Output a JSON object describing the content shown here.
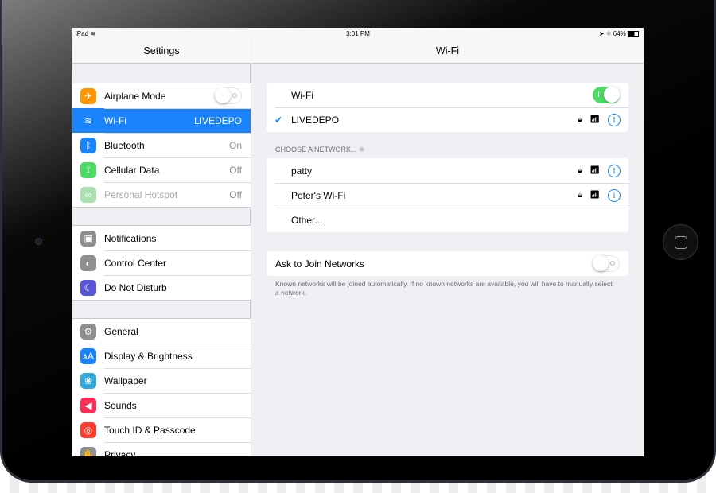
{
  "status": {
    "device": "iPad",
    "time": "3:01 PM",
    "battery": "64%"
  },
  "sidebar": {
    "title": "Settings",
    "groups": [
      [
        {
          "label": "Airplane Mode",
          "icon": "airplane-icon",
          "color": "#ff9500",
          "toggle": false
        },
        {
          "label": "Wi-Fi",
          "icon": "wifi-icon",
          "color": "#1a82fb",
          "value": "LIVEDEPO",
          "selected": true
        },
        {
          "label": "Bluetooth",
          "icon": "bluetooth-icon",
          "color": "#1a82fb",
          "value": "On"
        },
        {
          "label": "Cellular Data",
          "icon": "antenna-icon",
          "color": "#4cd964",
          "value": "Off"
        },
        {
          "label": "Personal Hotspot",
          "icon": "hotspot-icon",
          "color": "#a8e0b0",
          "value": "Off",
          "disabled": true
        }
      ],
      [
        {
          "label": "Notifications",
          "icon": "notifications-icon",
          "color": "#8e8e93"
        },
        {
          "label": "Control Center",
          "icon": "control-center-icon",
          "color": "#8e8e93"
        },
        {
          "label": "Do Not Disturb",
          "icon": "moon-icon",
          "color": "#5856d6"
        }
      ],
      [
        {
          "label": "General",
          "icon": "gear-icon",
          "color": "#8e8e93"
        },
        {
          "label": "Display & Brightness",
          "icon": "display-icon",
          "color": "#1a82fb"
        },
        {
          "label": "Wallpaper",
          "icon": "wallpaper-icon",
          "color": "#34aadc"
        },
        {
          "label": "Sounds",
          "icon": "speaker-icon",
          "color": "#ff2d55"
        },
        {
          "label": "Touch ID & Passcode",
          "icon": "fingerprint-icon",
          "color": "#ff3b30"
        },
        {
          "label": "Privacy",
          "icon": "hand-icon",
          "color": "#8e8e93"
        }
      ]
    ]
  },
  "detail": {
    "title": "Wi-Fi",
    "wifi_label": "Wi-Fi",
    "wifi_on": true,
    "connected": "LIVEDEPO",
    "choose_header": "CHOOSE A NETWORK...",
    "networks": [
      {
        "name": "patty",
        "secured": true
      },
      {
        "name": "Peter's Wi-Fi",
        "secured": true
      }
    ],
    "other": "Other...",
    "ask_label": "Ask to Join Networks",
    "ask_on": false,
    "ask_footer": "Known networks will be joined automatically. If no known networks are available, you will have to manually select a network."
  }
}
